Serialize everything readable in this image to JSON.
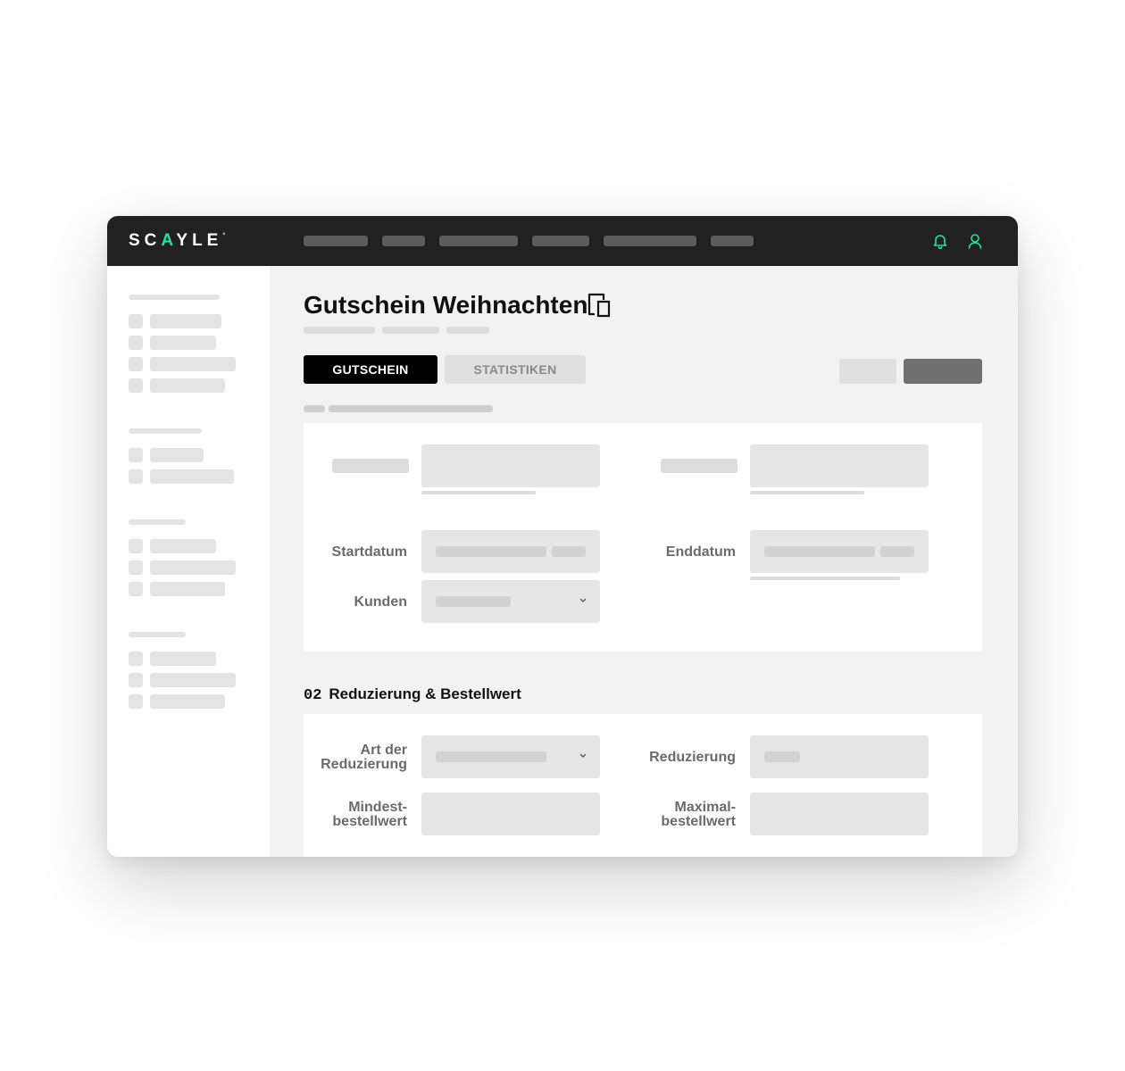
{
  "app": {
    "logo": {
      "prefix": "SC",
      "accent": "A",
      "suffix": "YLE",
      "mark": "°"
    },
    "accent_color": "#22e39a",
    "header_icons": [
      "bell-icon",
      "user-icon"
    ]
  },
  "page": {
    "title": "Gutschein Weihnachten",
    "copy_icon": "copy-icon"
  },
  "tabs": [
    {
      "label": "GUTSCHEIN",
      "active": true
    },
    {
      "label": "STATISTIKEN",
      "active": false
    }
  ],
  "section1": {
    "fields": {
      "start_label": "Startdatum",
      "end_label": "Enddatum",
      "customers_label": "Kunden"
    }
  },
  "section2": {
    "number": "02",
    "title": "Reduzierung & Bestellwert",
    "fields": {
      "reduction_type_label_line1": "Art der",
      "reduction_type_label_line2": "Reduzierung",
      "reduction_label": "Reduzierung",
      "min_order_line1": "Mindest-",
      "min_order_line2": "bestellwert",
      "max_order_line1": "Maximal-",
      "max_order_line2": "bestellwert"
    }
  }
}
